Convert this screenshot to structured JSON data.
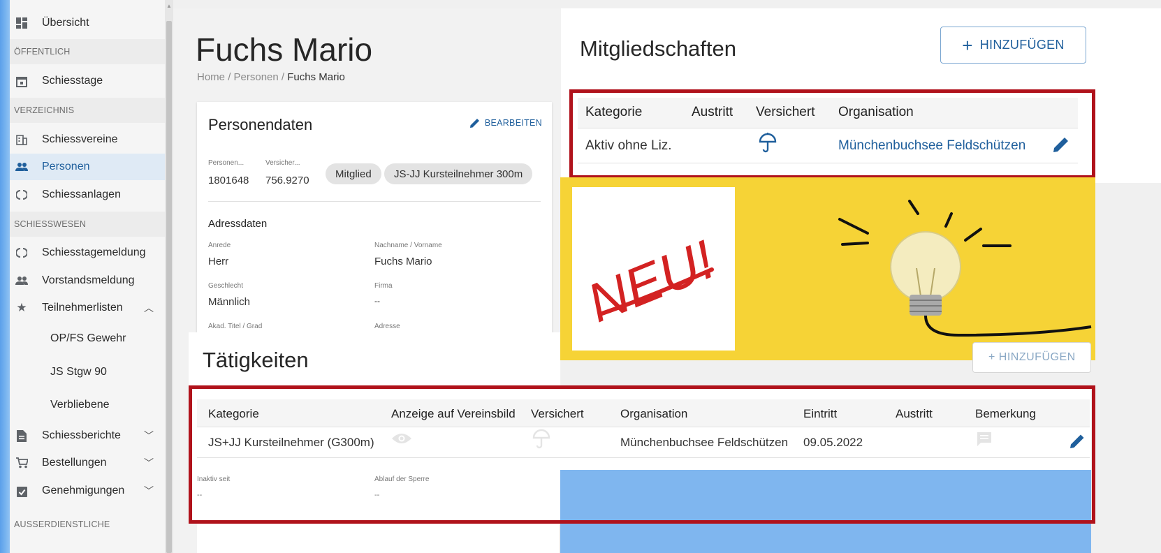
{
  "sidebar": {
    "items": [
      {
        "label": "Übersicht"
      },
      {
        "label": "Schiesstage"
      },
      {
        "label": "Schiessvereine"
      },
      {
        "label": "Personen"
      },
      {
        "label": "Schiessanlagen"
      },
      {
        "label": "Schiesstagemeldung"
      },
      {
        "label": "Vorstandsmeldung"
      },
      {
        "label": "Teilnehmerlisten"
      },
      {
        "label": "OP/FS Gewehr"
      },
      {
        "label": "JS Stgw 90"
      },
      {
        "label": "Verbliebene"
      },
      {
        "label": "Schiessberichte"
      },
      {
        "label": "Bestellungen"
      },
      {
        "label": "Genehmigungen"
      }
    ],
    "sections": [
      "ÖFFENTLICH",
      "VERZEICHNIS",
      "SCHIESSWESEN",
      "AUSSERDIENSTLICHE"
    ]
  },
  "page": {
    "title": "Fuchs Mario",
    "breadcrumb": {
      "home": "Home",
      "sep": "/",
      "level1": "Personen",
      "current": "Fuchs Mario"
    }
  },
  "person_card": {
    "title": "Personendaten",
    "edit_label": "BEARBEITEN",
    "person_nr_label": "Personen...",
    "person_nr_value": "1801648",
    "insurance_label": "Versicher...",
    "insurance_value": "756.9270",
    "chips": [
      "Mitglied",
      "JS-JJ Kursteilnehmer 300m"
    ],
    "address_title": "Adressdaten",
    "fields": {
      "anrede_label": "Anrede",
      "anrede_value": "Herr",
      "name_label": "Nachname / Vorname",
      "name_value": "Fuchs Mario",
      "geschlecht_label": "Geschlecht",
      "geschlecht_value": "Männlich",
      "firma_label": "Firma",
      "firma_value": "--",
      "titel_label": "Akad. Titel / Grad",
      "adresse_label": "Adresse"
    }
  },
  "memberships": {
    "title": "Mitgliedschaften",
    "add_label": "HINZUFÜGEN",
    "columns": [
      "Kategorie",
      "Austritt",
      "Versichert",
      "Organisation"
    ],
    "rows": [
      {
        "kategorie": "Aktiv ohne Liz.",
        "austritt": "",
        "organisation": "Münchenbuchsee Feldschützen"
      }
    ]
  },
  "banner": {
    "text": "NEU!"
  },
  "activities": {
    "title": "Tätigkeiten",
    "add_label": "+ HINZUFÜGEN",
    "columns": [
      "Kategorie",
      "Anzeige auf Vereinsbild",
      "Versichert",
      "Organisation",
      "Eintritt",
      "Austritt",
      "Bemerkung"
    ],
    "rows": [
      {
        "kategorie": "JS+JJ Kursteilnehmer (G300m)",
        "organisation": "Münchenbuchsee Feldschützen",
        "eintritt": "09.05.2022",
        "austritt": ""
      }
    ],
    "inaktiv_label": "Inaktiv seit",
    "inaktiv_value": "--",
    "sperre_label": "Ablauf der Sperre",
    "sperre_value": "--"
  },
  "colors": {
    "accent": "#1f5f9c",
    "highlight": "#b0121b",
    "banner": "#f6d336",
    "frame": "#7fb6ef"
  }
}
